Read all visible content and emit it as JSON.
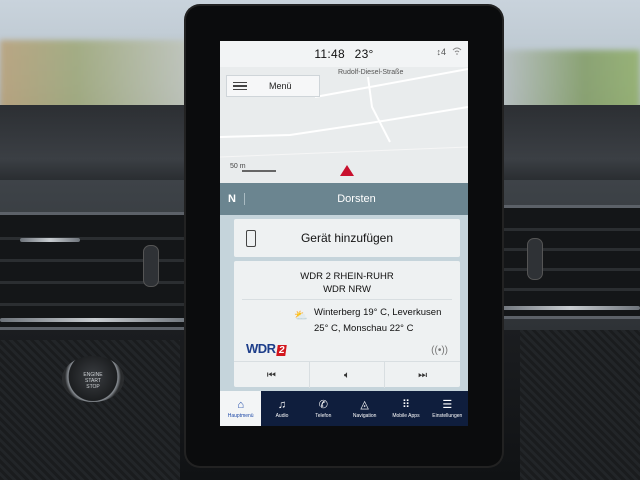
{
  "status": {
    "time": "11:48",
    "temperature": "23°",
    "right_indicator": "4"
  },
  "map": {
    "menu_label": "Menü",
    "street": "Rudolf-Diesel-Straße",
    "scale": "50 m"
  },
  "nav": {
    "direction": "N",
    "destination": "Dorsten"
  },
  "device": {
    "label": "Gerät hinzufügen"
  },
  "radio": {
    "station": "WDR 2 RHEIN-RUHR",
    "sub": "WDR NRW",
    "text_line1": "Winterberg 19° C, Leverkusen",
    "text_line2": "25° C, Monschau 22° C",
    "logo_text": "WDR",
    "logo_number": "2"
  },
  "tabs": [
    {
      "label": "Hauptmenü",
      "icon": "home-icon"
    },
    {
      "label": "Audio",
      "icon": "music-icon"
    },
    {
      "label": "Telefon",
      "icon": "phone-icon"
    },
    {
      "label": "Navigation",
      "icon": "navigation-icon"
    },
    {
      "label": "Mobile Apps",
      "icon": "apps-icon"
    },
    {
      "label": "Einstellungen",
      "icon": "settings-icon"
    }
  ],
  "colors": {
    "nav_bar": "#6b8590",
    "tab_bar": "#0f1e3d",
    "panel_bg": "#c5d4db"
  }
}
